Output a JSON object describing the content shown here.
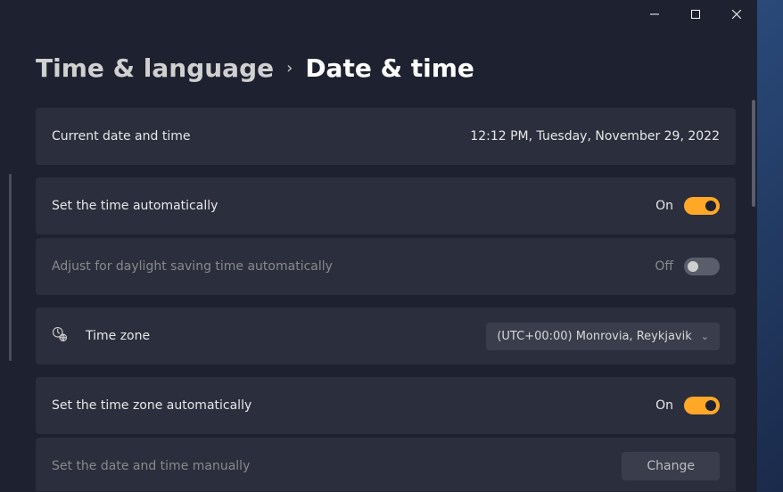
{
  "window": {
    "minimize_icon": "minimize",
    "maximize_icon": "maximize",
    "close_icon": "close"
  },
  "breadcrumb": {
    "parent": "Time & language",
    "current": "Date & time"
  },
  "panels": {
    "current": {
      "label": "Current date and time",
      "value": "12:12 PM, Tuesday, November 29, 2022"
    },
    "auto_time": {
      "label": "Set the time automatically",
      "state": "On"
    },
    "dst": {
      "label": "Adjust for daylight saving time automatically",
      "state": "Off"
    },
    "timezone": {
      "label": "Time zone",
      "value": "(UTC+00:00) Monrovia, Reykjavik"
    },
    "auto_tz": {
      "label": "Set the time zone automatically",
      "state": "On"
    },
    "manual": {
      "label": "Set the date and time manually",
      "button": "Change"
    }
  }
}
